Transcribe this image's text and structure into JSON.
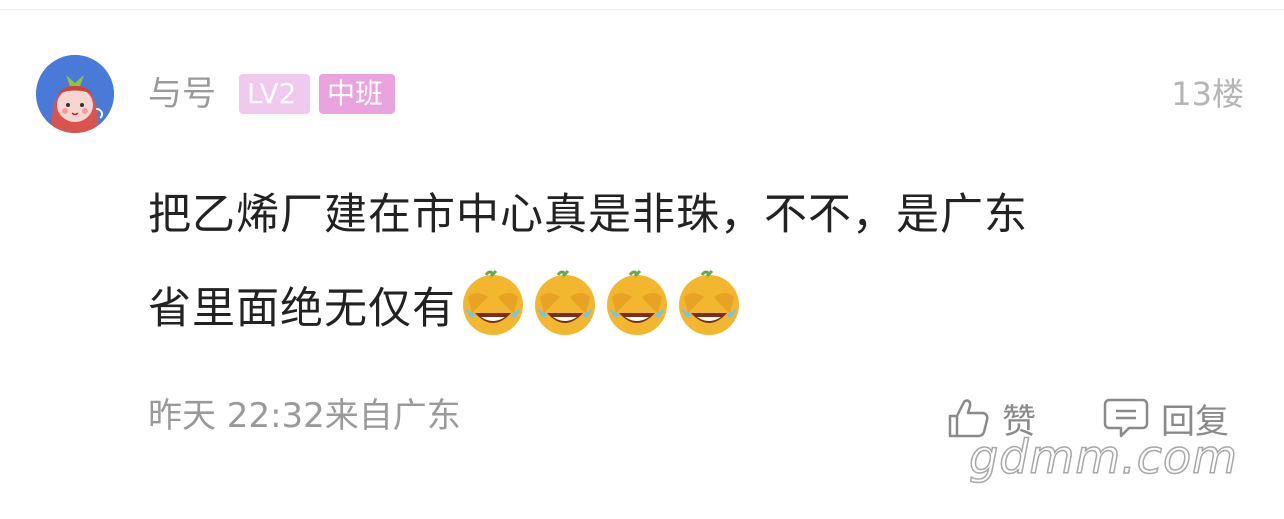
{
  "user": {
    "name": "与号",
    "level_badge": "LV2",
    "class_badge": "中班",
    "avatar_icon": "strawberry-girl-avatar-icon"
  },
  "floor": "13楼",
  "content": {
    "line1": "把乙烯厂建在市中心真是非珠，不不，是广东",
    "line2": "省里面绝无仅有",
    "emoji_name": "facepalm-crying-laughing-icon",
    "emoji_count": 4
  },
  "meta": {
    "time_location": "昨天 22:32来自广东"
  },
  "actions": {
    "like_label": "赞",
    "reply_label": "回复"
  },
  "watermark": "gdmm.com",
  "colors": {
    "badge_lv": "#f1c9ee",
    "badge_class": "#e9a4df",
    "avatar_bg": "#4a7ad8",
    "emoji": "#f2b62f"
  }
}
